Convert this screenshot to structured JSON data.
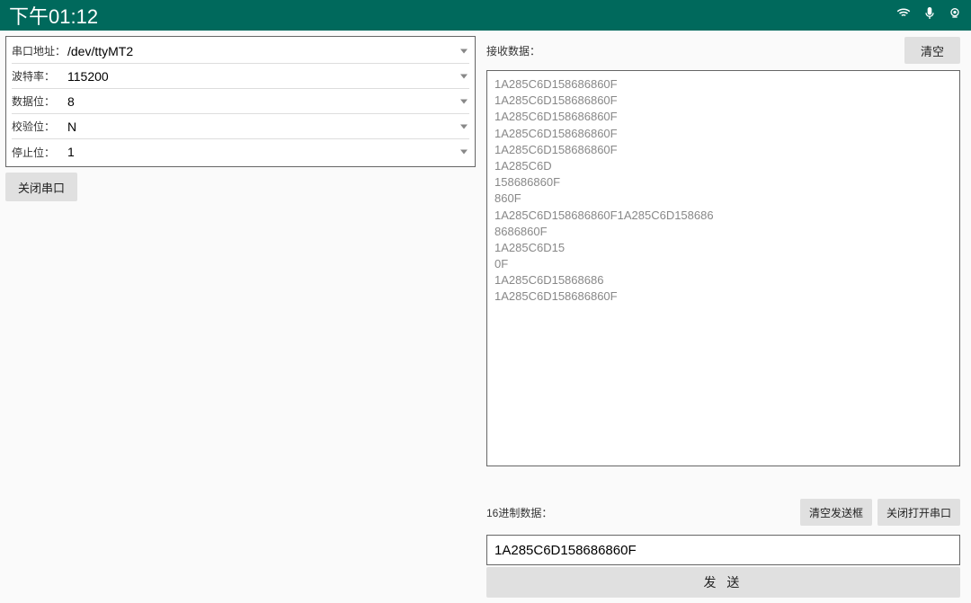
{
  "status_bar": {
    "time": "下午01:12"
  },
  "config": {
    "address_label": "串口地址：",
    "address_value": "/dev/ttyMT2",
    "baud_label": "波特率：",
    "baud_value": "115200",
    "databits_label": "数据位：",
    "databits_value": "8",
    "parity_label": "校验位：",
    "parity_value": "N",
    "stopbits_label": "停止位：",
    "stopbits_value": "1"
  },
  "buttons": {
    "close_serial": "关闭串口",
    "clear": "清空",
    "clear_send": "清空发送框",
    "close_open_serial": "关闭打开串口",
    "send": "发 送"
  },
  "receive": {
    "label": "接收数据：",
    "data": "1A285C6D158686860F\n1A285C6D158686860F\n1A285C6D158686860F\n1A285C6D158686860F\n1A285C6D158686860F\n1A285C6D\n158686860F\n860F\n1A285C6D158686860F1A285C6D158686\n8686860F\n1A285C6D15\n0F\n1A285C6D15868686\n1A285C6D158686860F"
  },
  "send": {
    "label": "16进制数据：",
    "value": "1A285C6D158686860F"
  }
}
